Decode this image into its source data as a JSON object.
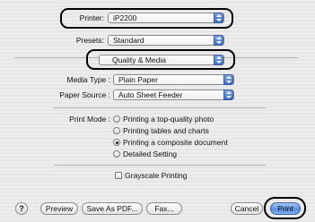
{
  "printer": {
    "label": "Printer:",
    "value": "iP2200"
  },
  "presets": {
    "label": "Presets:",
    "value": "Standard"
  },
  "panel": {
    "value": "Quality & Media"
  },
  "media_type": {
    "label": "Media Type :",
    "value": "Plain Paper"
  },
  "paper_source": {
    "label": "Paper Source :",
    "value": "Auto Sheet Feeder"
  },
  "print_mode": {
    "label": "Print Mode :",
    "options": [
      {
        "label": "Printing a top-quality photo",
        "selected": false
      },
      {
        "label": "Printing tables and charts",
        "selected": false
      },
      {
        "label": "Printing a composite document",
        "selected": true
      },
      {
        "label": "Detailed Setting",
        "selected": false
      }
    ]
  },
  "grayscale": {
    "label": "Grayscale Printing",
    "checked": false
  },
  "buttons": {
    "help": "?",
    "preview": "Preview",
    "save_as_pdf": "Save As PDF...",
    "fax": "Fax...",
    "cancel": "Cancel",
    "print": "Print"
  }
}
